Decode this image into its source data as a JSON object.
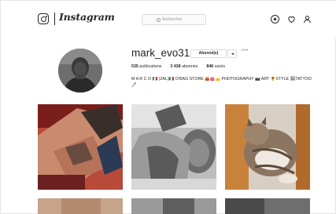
{
  "header": {
    "logo_text": "Instagram",
    "search_placeholder": "Rechercher",
    "icons": [
      "instagram-logo-icon",
      "search-icon",
      "compass-icon",
      "heart-icon",
      "person-icon"
    ]
  },
  "profile": {
    "username": "mark_evo31",
    "follow_button": "Abonné(e)",
    "more_label": "•••",
    "stats": [
      {
        "value": "535",
        "label": "publications"
      },
      {
        "value": "3 438",
        "label": "abonnés"
      },
      {
        "value": "846",
        "label": "suivis"
      }
    ],
    "bio": "M A R C O 🇮🇹 (ZAL)🇮🇹 O'BAG STORE 👜👛👝 PHOTOGRAPHY 📷 ART 🌻STYLE 🖼TATTOO🖋"
  },
  "posts": [
    {
      "name": "post-man-lying-tattoo"
    },
    {
      "name": "post-man-shirtless-tattoo-bw"
    },
    {
      "name": "post-cat-lying"
    },
    {
      "name": "post-row2-1"
    },
    {
      "name": "post-row2-2"
    },
    {
      "name": "post-row2-3"
    }
  ],
  "colors": {
    "text": "#262626",
    "border": "#dbdbdb",
    "muted": "#999999"
  }
}
